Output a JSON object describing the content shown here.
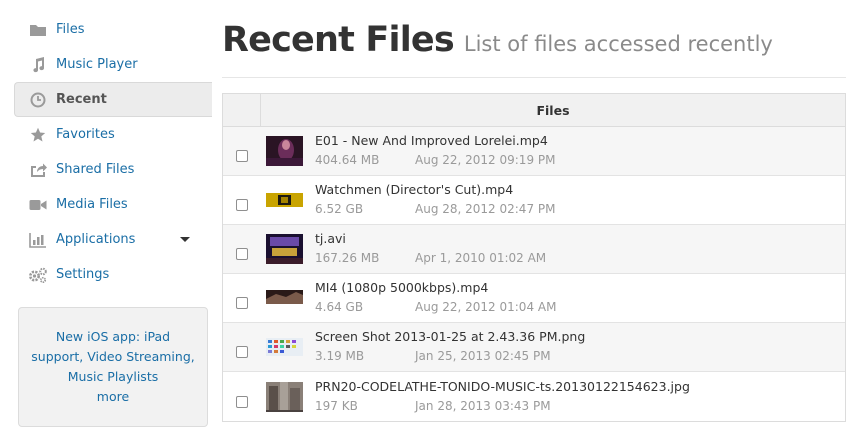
{
  "sidebar": {
    "items": [
      {
        "label": "Files",
        "icon": "folder-icon",
        "active": false
      },
      {
        "label": "Music Player",
        "icon": "music-note-icon",
        "active": false
      },
      {
        "label": "Recent",
        "icon": "clock-icon",
        "active": true
      },
      {
        "label": "Favorites",
        "icon": "star-icon",
        "active": false
      },
      {
        "label": "Shared Files",
        "icon": "share-icon",
        "active": false
      },
      {
        "label": "Media Files",
        "icon": "video-camera-icon",
        "active": false
      },
      {
        "label": "Applications",
        "icon": "bar-chart-icon",
        "active": false
      },
      {
        "label": "Settings",
        "icon": "gears-icon",
        "active": false
      }
    ],
    "promo": {
      "text": "New iOS app: iPad support, Video Streaming, Music Playlists",
      "more": "more"
    }
  },
  "header": {
    "title": "Recent Files",
    "subtitle": "List of files accessed recently"
  },
  "table": {
    "column_header": "Files",
    "rows": [
      {
        "name": "E01 - New And Improved Lorelei.mp4",
        "size": "404.64 MB",
        "date": "Aug 22, 2012 09:19 PM"
      },
      {
        "name": "Watchmen (Director's Cut).mp4",
        "size": "6.52 GB",
        "date": "Aug 28, 2012 02:47 PM"
      },
      {
        "name": "tj.avi",
        "size": "167.26 MB",
        "date": "Apr 1, 2010 01:02 AM"
      },
      {
        "name": "MI4 (1080p 5000kbps).mp4",
        "size": "4.64 GB",
        "date": "Aug 22, 2012 01:04 AM"
      },
      {
        "name": "Screen Shot 2013-01-25 at 2.43.36 PM.png",
        "size": "3.19 MB",
        "date": "Jan 25, 2013 02:45 PM"
      },
      {
        "name": "PRN20-CODELATHE-TONIDO-MUSIC-ts.20130122154623.jpg",
        "size": "197 KB",
        "date": "Jan 28, 2013 03:43 PM"
      }
    ]
  },
  "colors": {
    "link": "#1a6ea6",
    "muted": "#9a9a9a",
    "icon": "#9a9a9a"
  }
}
